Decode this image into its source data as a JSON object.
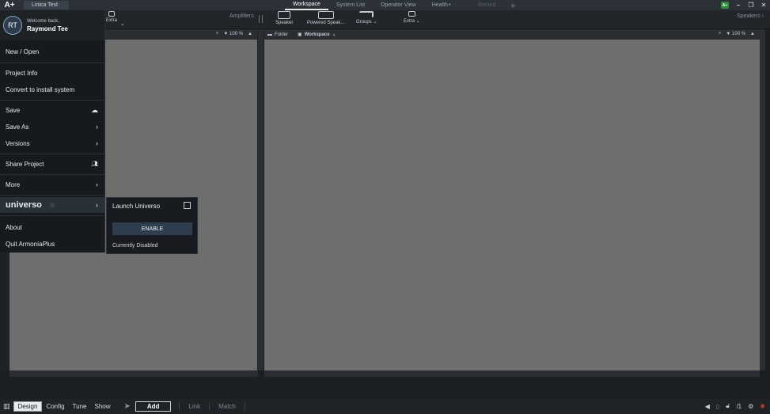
{
  "app": {
    "logo": "A+",
    "project_name": "Linica Test"
  },
  "main_tabs": [
    {
      "label": "Workspace"
    },
    {
      "label": "System List"
    },
    {
      "label": "Operator View"
    },
    {
      "label": "Health+"
    },
    {
      "label": "Record"
    }
  ],
  "toolbar": {
    "extra_left": "Extra",
    "amplifiers": "Amplifiers",
    "speaker": "Speaker",
    "powered_speaker": "Powered Speak...",
    "groups": "Groups",
    "extra": "Extra",
    "speakers": "Speakers"
  },
  "left_panel": {
    "zoom": "100 %"
  },
  "right_panel": {
    "folder": "Folder",
    "workspace": "Workspace",
    "zoom": "100 %"
  },
  "menu": {
    "avatar_initials": "RT",
    "welcome": "Welcome back,",
    "user_name": "Raymond Tee",
    "items": {
      "new_open": "New / Open",
      "project_info": "Project Info",
      "convert": "Convert to install system",
      "save": "Save",
      "save_as": "Save As",
      "versions": "Versions",
      "share": "Share Project",
      "more": "More",
      "universo": "universo",
      "about": "About",
      "quit": "Quit ArmoníaPlus"
    }
  },
  "submenu": {
    "launch": "Launch Universo",
    "enable": "ENABLE",
    "status": "Currently Disabled"
  },
  "bottom": {
    "modes": [
      "Design",
      "Config",
      "Tune",
      "Show"
    ],
    "tools": [
      "Add",
      "Link",
      "Match"
    ],
    "page_counter": "/1"
  },
  "colors": {
    "canvas": "#6e6e6e",
    "menu_bg": "#161a1e",
    "enable_btn": "#2f3e4e",
    "badge_green": "#2e8b3c"
  }
}
